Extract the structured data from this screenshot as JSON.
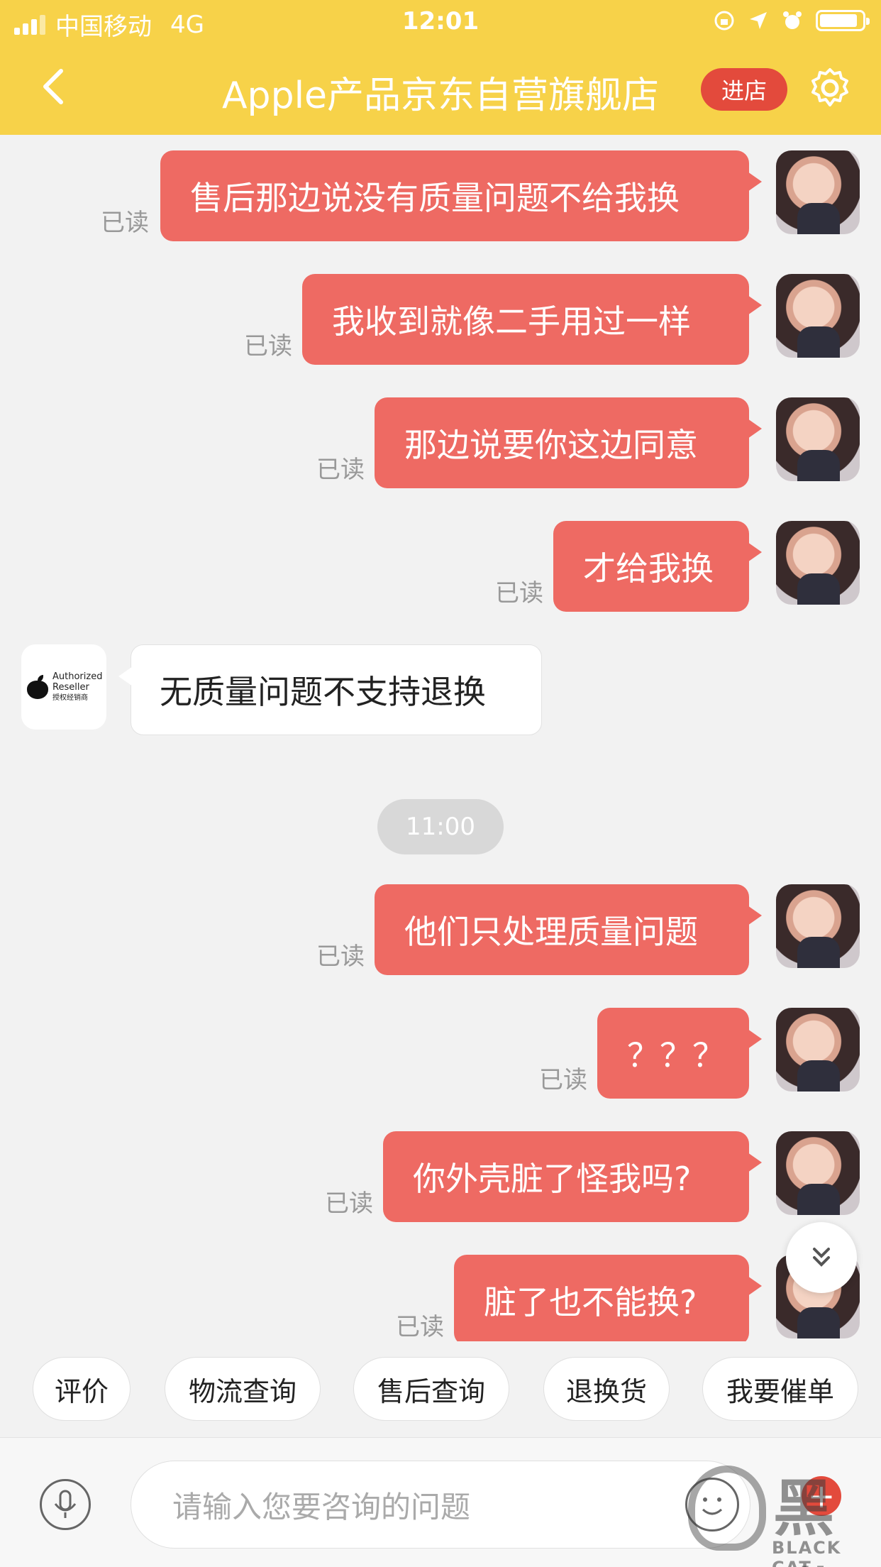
{
  "status": {
    "carrier": "中国移动",
    "network": "4G",
    "time": "12:01"
  },
  "header": {
    "title": "Apple产品京东自营旗舰店",
    "enter_label": "进店"
  },
  "messages": [
    {
      "text": "售后那边说没有质量问题不给我换",
      "read": "已读"
    },
    {
      "text": "我收到就像二手用过一样",
      "read": "已读"
    },
    {
      "text": "那边说要你这边同意",
      "read": "已读"
    },
    {
      "text": "才给我换",
      "read": "已读"
    },
    {
      "text": "无质量问题不支持退换"
    },
    {
      "text": "他们只处理质量问题",
      "read": "已读"
    },
    {
      "text": "？？？",
      "read": "已读"
    },
    {
      "text": "你外壳脏了怪我吗?",
      "read": "已读"
    },
    {
      "text": "脏了也不能换?",
      "read": "已读"
    }
  ],
  "timestamp": "11:00",
  "shop_avatar": {
    "line1": "Authorized",
    "line2": "Reseller",
    "line3": "授权经销商"
  },
  "quick_replies": [
    "评价",
    "物流查询",
    "售后查询",
    "退换货",
    "我要催单"
  ],
  "input": {
    "placeholder": "请输入您要咨询的问题"
  },
  "watermark": {
    "cn": "黑猫",
    "en": "BLACK CAT"
  },
  "colors": {
    "header_bg": "#f7d249",
    "bubble_me": "#ee6a63",
    "accent_red": "#e34a3c",
    "page_bg": "#f2f2f2"
  }
}
